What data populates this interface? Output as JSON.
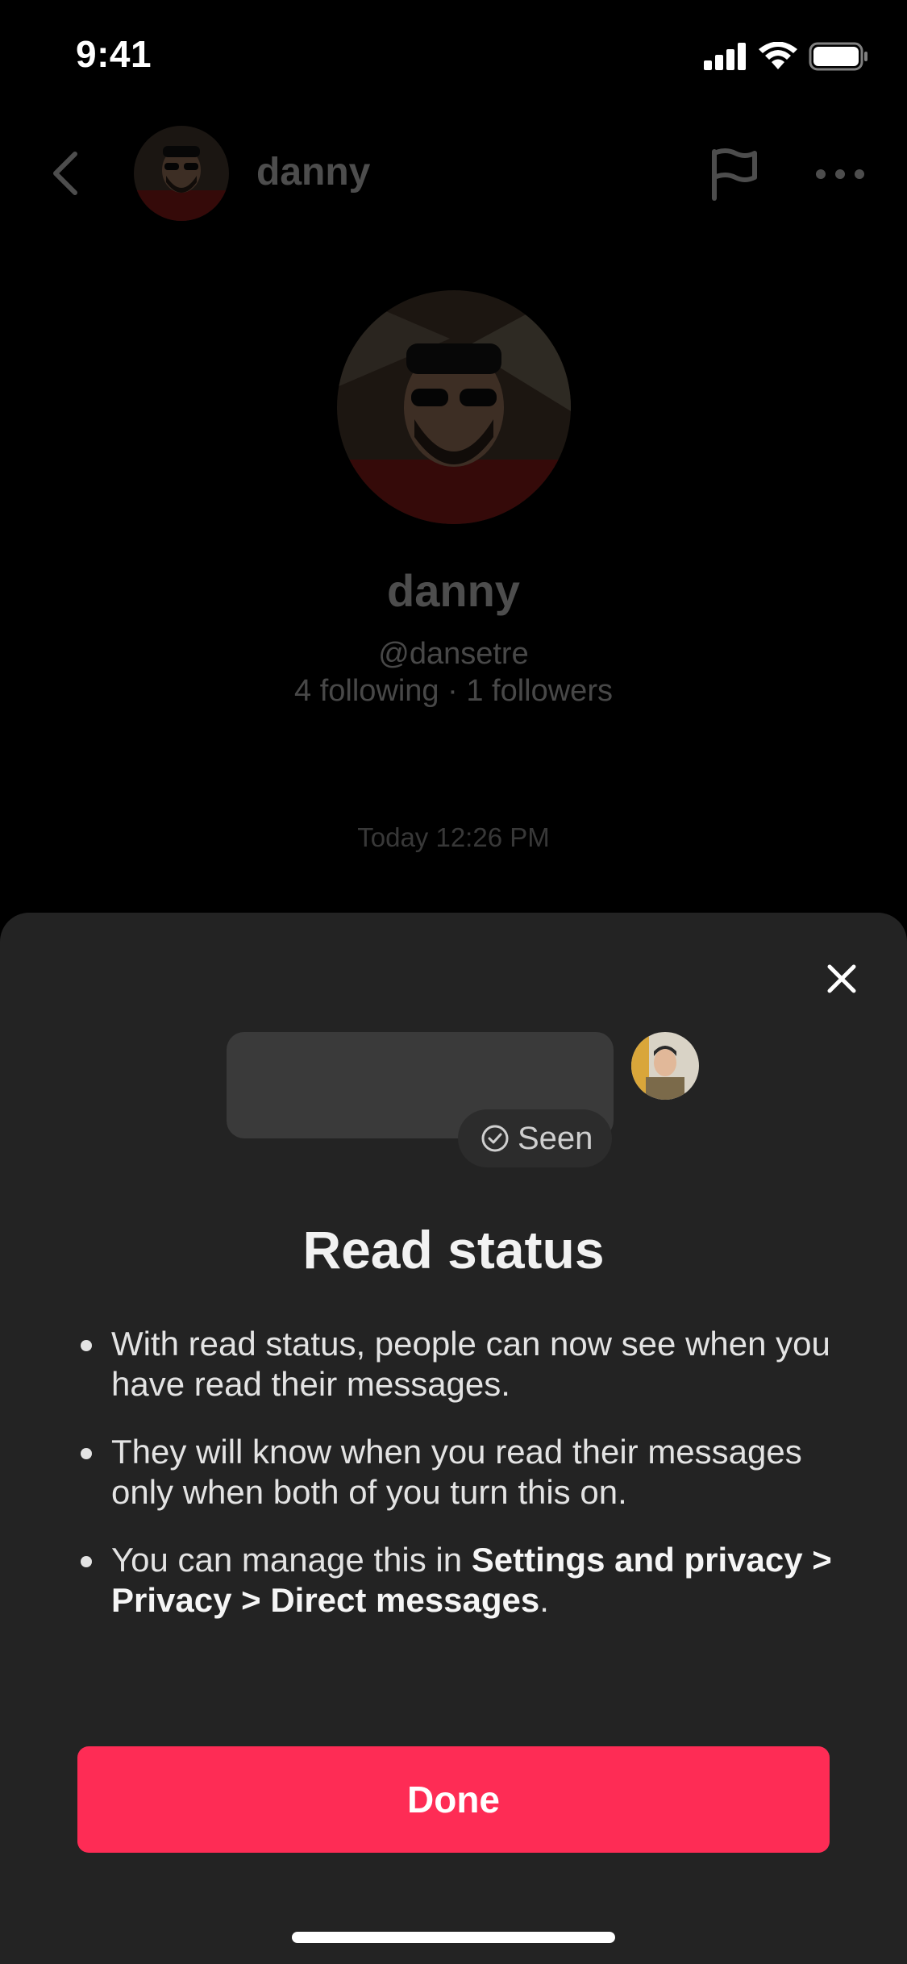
{
  "status_bar": {
    "time": "9:41",
    "icons": [
      "cellular-signal-icon",
      "wifi-icon",
      "battery-icon"
    ]
  },
  "chat_header": {
    "name": "danny",
    "icons": [
      "back-chevron-icon",
      "flag-icon",
      "more-icon"
    ]
  },
  "profile": {
    "name": "danny",
    "handle": "@dansetre",
    "follow_stats": "4 following · 1 followers"
  },
  "chat": {
    "timestamp": "Today 12:26 PM"
  },
  "sheet": {
    "seen_label": "Seen",
    "title": "Read status",
    "bullet_1": "With read status, people can now see when you have read their messages.",
    "bullet_2": "They will know when you read their messages only when both of you turn this on.",
    "bullet_3_prefix": "You can manage this in ",
    "bullet_3_path": "Settings and privacy > Privacy > Direct messages",
    "bullet_3_suffix": ".",
    "done_label": "Done"
  },
  "colors": {
    "accent": "#fe2c55",
    "sheet_background": "#232323",
    "page_background": "#000000"
  }
}
